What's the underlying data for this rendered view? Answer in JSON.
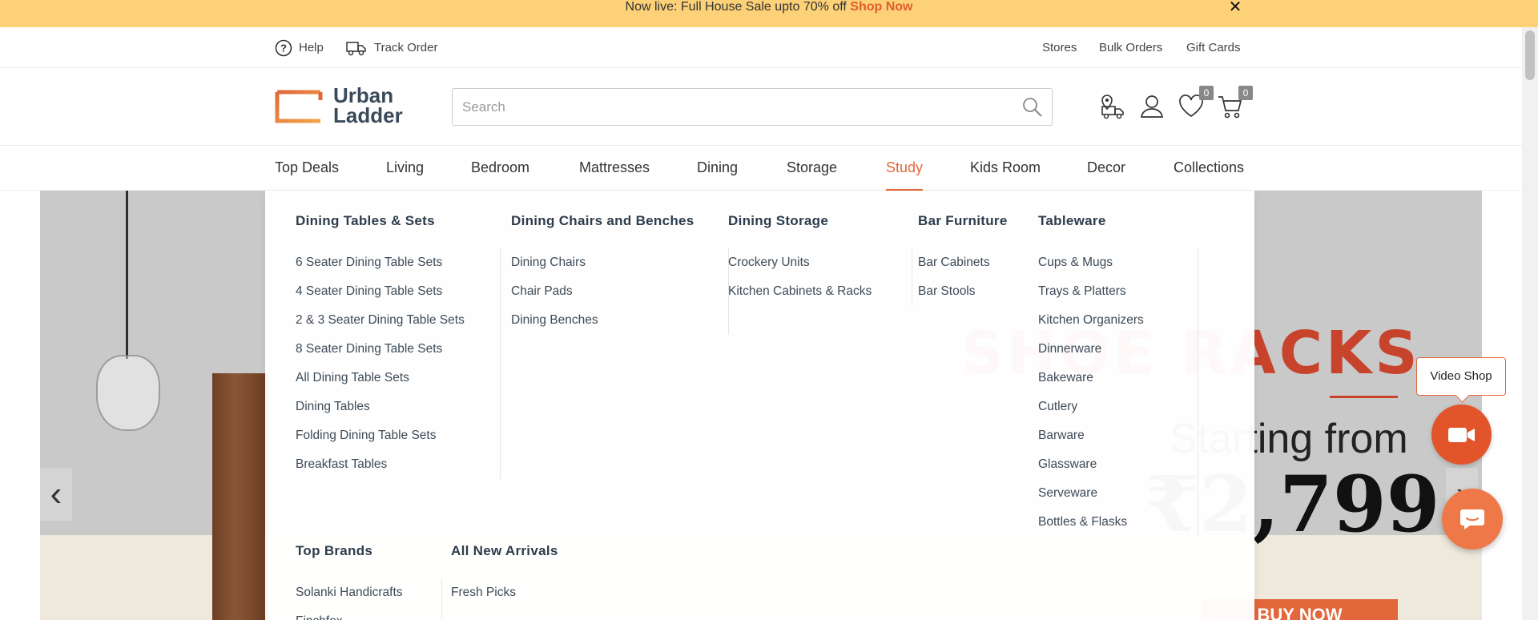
{
  "promo": {
    "text": "Now live: Full House Sale upto 70% off ",
    "link": "Shop Now",
    "close": "✕"
  },
  "utility": {
    "left": [
      {
        "label": "Help",
        "icon": "help-icon"
      },
      {
        "label": "Track Order",
        "icon": "truck-icon"
      }
    ],
    "right": [
      "Stores",
      "Bulk Orders",
      "Gift Cards"
    ]
  },
  "header": {
    "logo_line1": "Urban",
    "logo_line2": "Ladder",
    "search_placeholder": "Search",
    "wishlist_count": "0",
    "cart_count": "0"
  },
  "nav": {
    "items": [
      "Top Deals",
      "Living",
      "Bedroom",
      "Mattresses",
      "Dining",
      "Storage",
      "Study",
      "Kids Room",
      "Decor",
      "Collections"
    ],
    "active": "Study"
  },
  "mega_menu": {
    "columns": [
      {
        "title": "Dining Tables & Sets",
        "items": [
          "6 Seater Dining Table Sets",
          "4 Seater Dining Table Sets",
          "2 & 3 Seater Dining Table Sets",
          "8 Seater Dining Table Sets",
          "All Dining Table Sets",
          "Dining Tables",
          "Folding Dining Table Sets",
          "Breakfast Tables"
        ]
      },
      {
        "title": "Dining Chairs and Benches",
        "items": [
          "Dining Chairs",
          "Chair Pads",
          "Dining Benches"
        ]
      },
      {
        "title": "Dining Storage",
        "items": [
          "Crockery Units",
          "Kitchen Cabinets & Racks"
        ]
      },
      {
        "title": "Bar Furniture",
        "items": [
          "Bar Cabinets",
          "Bar Stools"
        ]
      },
      {
        "title": "Tableware",
        "items": [
          "Cups & Mugs",
          "Trays & Platters",
          "Kitchen Organizers",
          "Dinnerware",
          "Bakeware",
          "Cutlery",
          "Barware",
          "Glassware",
          "Serveware",
          "Bottles & Flasks"
        ]
      }
    ],
    "bottom_columns": [
      {
        "title": "Top Brands",
        "items": [
          "Solanki Handicrafts",
          "Finchfox"
        ]
      },
      {
        "title": "All New Arrivals",
        "items": [
          "Fresh Picks"
        ]
      }
    ]
  },
  "hero": {
    "title": "SHOE RACKS",
    "subtitle": "Starting from",
    "price": "₹2,799",
    "cta": "BUY NOW",
    "prev": "‹",
    "next": "›"
  },
  "floating": {
    "video_label": "Video Shop"
  },
  "colors": {
    "accent": "#e2673a",
    "promo_bg": "#fcd177",
    "text_dark": "#2d3c4c"
  }
}
